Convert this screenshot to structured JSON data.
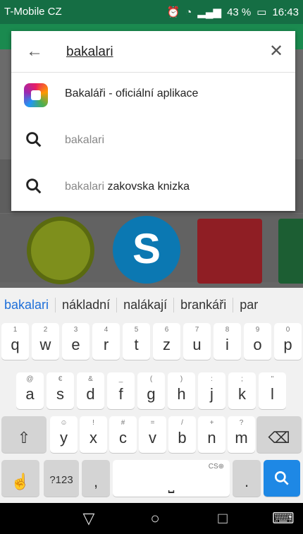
{
  "status_bar": {
    "carrier": "T-Mobile CZ",
    "battery": "43 %",
    "time": "16:43"
  },
  "search": {
    "query": "bakalari",
    "back_icon": "arrow-left-icon",
    "clear_icon": "close-icon"
  },
  "suggestions": [
    {
      "type": "app",
      "icon": "app-logo-icon",
      "text": "Bakaláři - oficiální aplikace"
    },
    {
      "type": "query",
      "icon": "search-icon",
      "text": "bakalari"
    },
    {
      "type": "query",
      "icon": "search-icon",
      "text_gray": "bakalari",
      "text_bold": "zakovska knizka"
    }
  ],
  "keyboard": {
    "word_suggestions": [
      "bakalari",
      "nákladní",
      "nalákají",
      "brankáři",
      "par"
    ],
    "rows": [
      [
        {
          "main": "q",
          "sub": "1"
        },
        {
          "main": "w",
          "sub": "2"
        },
        {
          "main": "e",
          "sub": "3"
        },
        {
          "main": "r",
          "sub": "4"
        },
        {
          "main": "t",
          "sub": "5"
        },
        {
          "main": "z",
          "sub": "6"
        },
        {
          "main": "u",
          "sub": "7"
        },
        {
          "main": "i",
          "sub": "8"
        },
        {
          "main": "o",
          "sub": "9"
        },
        {
          "main": "p",
          "sub": "0"
        }
      ],
      [
        {
          "main": "a",
          "sub": "@"
        },
        {
          "main": "s",
          "sub": "€"
        },
        {
          "main": "d",
          "sub": "&"
        },
        {
          "main": "f",
          "sub": "_"
        },
        {
          "main": "g",
          "sub": "("
        },
        {
          "main": "h",
          "sub": ")"
        },
        {
          "main": "j",
          "sub": ":"
        },
        {
          "main": "k",
          "sub": ";"
        },
        {
          "main": "l",
          "sub": "\""
        }
      ],
      [
        {
          "main": "y",
          "sub": "☺"
        },
        {
          "main": "x",
          "sub": "!"
        },
        {
          "main": "c",
          "sub": "#"
        },
        {
          "main": "v",
          "sub": "="
        },
        {
          "main": "b",
          "sub": "/"
        },
        {
          "main": "n",
          "sub": "+"
        },
        {
          "main": "m",
          "sub": "?"
        }
      ]
    ],
    "shift_icon": "shift-icon",
    "backspace_icon": "backspace-icon",
    "gesture_icon": "hand-gesture-icon",
    "symbols_label": "?123",
    "comma": ",",
    "space_label": "CS⊕",
    "period": ".",
    "search_icon": "search-icon"
  },
  "colors": {
    "status_bar": "#156e44",
    "accent": "#1e88e5",
    "suggest_first": "#1e6fd9"
  }
}
